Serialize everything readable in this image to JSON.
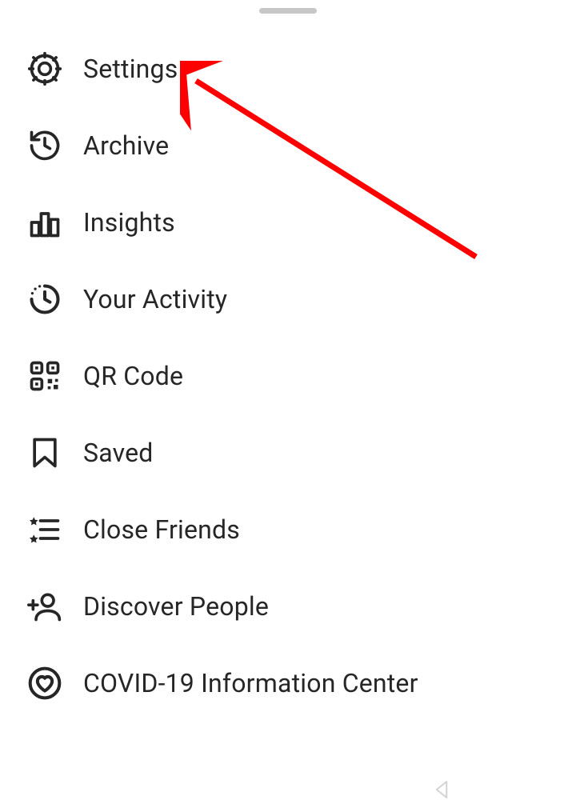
{
  "menu": {
    "items": [
      {
        "key": "settings",
        "label": "Settings"
      },
      {
        "key": "archive",
        "label": "Archive"
      },
      {
        "key": "insights",
        "label": "Insights"
      },
      {
        "key": "your-activity",
        "label": "Your Activity"
      },
      {
        "key": "qr-code",
        "label": "QR Code"
      },
      {
        "key": "saved",
        "label": "Saved"
      },
      {
        "key": "close-friends",
        "label": "Close Friends"
      },
      {
        "key": "discover-people",
        "label": "Discover People"
      },
      {
        "key": "covid-info",
        "label": "COVID-19 Information Center"
      }
    ]
  },
  "annotation": {
    "arrow_color": "#ff0000"
  }
}
